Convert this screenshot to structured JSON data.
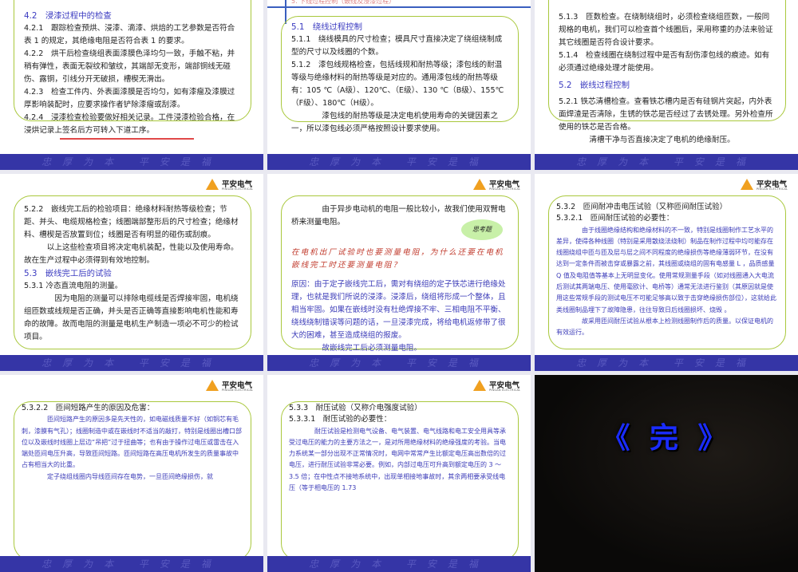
{
  "logo": {
    "name": "平安电气",
    "sub": "PINGAN ELECTRICAL"
  },
  "footer_slogan": "忠厚为本 平安是福",
  "slides": [
    {
      "paragraphs": [
        {
          "t": "4.2　浸漆过程中的检查",
          "s": "head"
        },
        {
          "t": "4.2.1　跟踪检查预烘、浸漆、滴漆、烘焙的工艺参数是否符合表 1 的规定，其绝缘电阻是否符合表 1 的要求。"
        },
        {
          "t": "4.2.2　烘干后检查绕组表面漆膜色泽均匀一致，手触不粘，并稍有弹性，表面无裂纹和皱纹，其端部无变形，端部铜线无碰伤、露铜，引线分开无破损，槽楔无滑出。"
        },
        {
          "t": "4.2.3　检查工件内、外表面漆膜是否均匀，如有漆瘤及漆膜过厚影响装配时，应要求操作者铲除漆瘤或刮漆。"
        },
        {
          "t": "4.2.4　浸漆检查检验要做好相关记录。工件浸漆检验合格，在浸烘记录上签名后方可转入下道工序。"
        }
      ]
    },
    {
      "header": "5. 下线过程控制（嵌线及浸漆过程）",
      "paragraphs": [
        {
          "t": "5.1　绕线过程控制",
          "s": "head"
        },
        {
          "t": "5.1.1　绕线模具的尺寸检查；模具尺寸直接决定了绕组绕制成型的尺寸以及线圈的个数。"
        },
        {
          "t": "5.1.2　漆包线规格检查，包括线规和耐热等级；漆包线的耐温等级与绝缘材料的耐热等级是对应的。通用漆包线的耐热等级有：105 ℃（A级）、120℃、（E级）、130 ℃（B级）、155℃（F级）、180℃（H级）。"
        },
        {
          "t": "漆包线的耐热等级是决定电机使用寿命的关键因素之一，所以漆包线必须严格按照设计要求使用。",
          "i": 4
        }
      ]
    },
    {
      "paragraphs": [
        {
          "t": "5.1.3　匝数检查。在绕制绕组时，必须检查绕组匝数，一般同规格的电机，我们可以检查首个线圈后，采用称重的办法来验证其它线圈是否符合设计要求。"
        },
        {
          "t": "5.1.4　检查线圈在绕制过程中是否有刮伤漆包线的痕迹。如有必须通过绝缘处理才能使用。"
        },
        {
          "t": "5.2　嵌线过程控制",
          "s": "head gap"
        },
        {
          "t": "5.2.1 铁芯清槽检查。查看铁芯槽内是否有硅钢片突起，内外表面焊渣是否清除，生锈的铁芯是否经过了去锈处理。另外检查所使用的铁芯是否合格。",
          "s": "gap"
        },
        {
          "t": "清槽干净与否直接决定了电机的绝缘耐压。",
          "i": 4
        }
      ]
    },
    {
      "paragraphs": [
        {
          "t": "5.2.2　嵌线完工后的检验项目：绝缘材料耐热等级检查；节距、并头、电缆规格检查；线圈端部整形后的尺寸检查；绝缘材料、槽楔是否放置到位；线圈是否有明显的碰伤或刮痕。"
        },
        {
          "t": "以上这些检查项目将决定电机装配，性能以及使用寿命。故在生产过程中必须得到有效地控制。",
          "i": 3
        },
        {
          "t": "5.3　嵌线完工后的试验",
          "s": "head"
        },
        {
          "t": "5.3.1 冷态直流电阻的测量。"
        },
        {
          "t": "因为电阻的测量可以排除电缆线是否焊接牢固，电机绕组匝数或线规是否正确，并头是否正确等直接影响电机性能和寿命的故障。故而电阻的测量是电机生产制造一项必不可少的检试项目。",
          "i": 4
        }
      ]
    },
    {
      "think": "思考题",
      "paragraphs": [
        {
          "t": "由于异步电动机的电阻一般比较小，故我们使用双臂电桥来测量电阻。",
          "i": 4
        },
        {
          "t": "在电机出厂试验时也要测量电阻，为什么还要在电机嵌线完工时还要测量电阻？",
          "s": "red",
          "gap": 22
        },
        {
          "t": "原因：由于定子嵌线完工后，需对有绕组的定子铁芯进行绝缘处理，也就是我们所说的浸漆。浸漆后，绕组将形成一个整体，且相当牢固。如果在嵌线时没有杜绝焊接不牢、三相电阻不平衡、绕线绕制错误等问题的话，一旦浸漆完成，将给电机返修带了很大的困难，甚至造成绕组的报废。",
          "s": "blue",
          "gap": 8
        },
        {
          "t": "故嵌线完工后必须测量电阻。",
          "s": "blue",
          "i": 4
        }
      ]
    },
    {
      "small": true,
      "paragraphs": [
        {
          "t": "5.3.2　匝间耐冲击电压试验（又称匝间耐压试验）",
          "big": true
        },
        {
          "t": "5.3.2.1　匝间耐压试验的必要性：",
          "big": true
        },
        {
          "t": "由于线圈绝缘结构和绝缘材料的不一致，特别是线圈制作工艺水平的差异，使得各种线圈（特别是采用散绕法绕制）制品在制作过程中均可能存在线圈绕组中匝与匝及层与层之间不同程度的绝缘损伤等绝缘薄弱环节，在没有达到一定条件而被击穿或暴露之前，其线圈或绕组的固有电感量 L ，品质感量 Q 值及电阻值等基本上无明显变化。使用常规测量手段（如对线圈通入大电流后测试其两端电压、使用毫欧计、电桥等）通常无法进行鉴别（其原因就是使用这些常规手段的测试电压不可能足够高以致于击穿绝缘损伤部位），这就给此类线圈制品埋下了故障隐患，往往导致日后线圈损坏、烧毁 。",
          "s": "blue",
          "i": 4
        },
        {
          "t": "故采用匝间耐压试验从根本上检测线圈制作后的质量。以保证电机的有效运行。",
          "s": "blue",
          "i": 4
        }
      ]
    },
    {
      "small": true,
      "paragraphs": [
        {
          "t": "5.3.2.2　匝间短路产生的原因及危害：",
          "big": true
        },
        {
          "t": "匝间短路产生的原因多是先天性的，如电磁线质量不好（如铜芯有毛刺，漆膜有气孔）；线圈制造中或在嵌线时不适当的敲打，特别是线圈出槽口部位以及嵌线时线圈上层边“吊把”过于扭曲等；也有由于操作过电压或雷击在入端处匝间电压升高，导致匝间短路。匝间短路在高压电机所发生的质量事故中占有相当大的比重。",
          "s": "blue",
          "i": 4
        },
        {
          "t": "定子绕组线圈内导线匝间存在电势，一旦匝间绝缘损伤，就",
          "s": "blue",
          "i": 4
        }
      ]
    },
    {
      "small": true,
      "paragraphs": [
        {
          "t": "5.3.3　耐压试验（又称介电强度试验）",
          "big": true
        },
        {
          "t": "5.3.3.1　耐压试验的必要性：",
          "big": true
        },
        {
          "t": "耐压试验是检测电气设备、电气装置、电气线路和电工安全用具等承受过电压的能力的主要方法之一，是对所用绝缘材料的绝缘强度的考验。当电力系统某一部分出现不正常情况时，电网中常常产生比额定电压高出数倍的过电压，进行耐压试验非常必要。例如，内部过电压可升高到额定电压的 3 ～ 3.5 倍；在中性点不接地系统中，出现单相接地事故时，其余两相要承受线电压（等于相电压的 1.73",
          "s": "blue",
          "i": 4
        }
      ]
    },
    {
      "end": "《 完 》"
    }
  ]
}
